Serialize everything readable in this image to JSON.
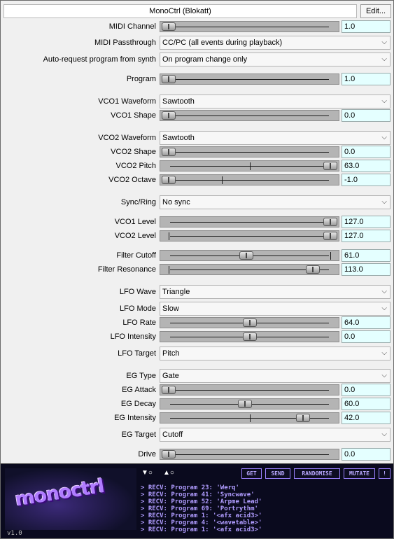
{
  "window": {
    "title": "MonoCtrl (Blokatt)",
    "edit_label": "Edit..."
  },
  "controls": [
    {
      "kind": "slider",
      "label": "MIDI Channel",
      "value": "1.0",
      "level": 0.0
    },
    {
      "kind": "dropdown",
      "label": "MIDI Passthrough",
      "value": "CC/PC (all events during playback)"
    },
    {
      "kind": "dropdown",
      "label": "Auto-request program from synth",
      "value": "On program change only"
    },
    {
      "kind": "slider",
      "label": "Program",
      "value": "1.0",
      "level": 0.0
    },
    {
      "kind": "dropdown",
      "label": "VCO1 Waveform",
      "value": "Sawtooth"
    },
    {
      "kind": "slider",
      "label": "VCO1 Shape",
      "value": "0.0",
      "level": 0.0
    },
    {
      "kind": "dropdown",
      "label": "VCO2 Waveform",
      "value": "Sawtooth"
    },
    {
      "kind": "slider",
      "label": "VCO2 Shape",
      "value": "0.0",
      "level": 0.0
    },
    {
      "kind": "slider",
      "label": "VCO2 Pitch",
      "value": "63.0",
      "level": 1.0,
      "tick": 0.5
    },
    {
      "kind": "slider",
      "label": "VCO2 Octave",
      "value": "-1.0",
      "level": 0.0,
      "tick": 0.33
    },
    {
      "kind": "dropdown",
      "label": "Sync/Ring",
      "value": "No sync"
    },
    {
      "kind": "slider",
      "label": "VCO1 Level",
      "value": "127.0",
      "level": 1.0
    },
    {
      "kind": "slider",
      "label": "VCO2 Level",
      "value": "127.0",
      "level": 1.0,
      "tick": 0.0
    },
    {
      "kind": "slider",
      "label": "Filter Cutoff",
      "value": "61.0",
      "level": 0.48,
      "tick": 1.0
    },
    {
      "kind": "slider",
      "label": "Filter Resonance",
      "value": "113.0",
      "level": 0.89,
      "tick": 0.0
    },
    {
      "kind": "dropdown",
      "label": "LFO Wave",
      "value": "Triangle"
    },
    {
      "kind": "dropdown",
      "label": "LFO Mode",
      "value": "Slow"
    },
    {
      "kind": "slider",
      "label": "LFO Rate",
      "value": "64.0",
      "level": 0.5
    },
    {
      "kind": "slider",
      "label": "LFO Intensity",
      "value": "0.0",
      "level": 0.5
    },
    {
      "kind": "dropdown",
      "label": "LFO Target",
      "value": "Pitch"
    },
    {
      "kind": "dropdown",
      "label": "EG Type",
      "value": "Gate"
    },
    {
      "kind": "slider",
      "label": "EG Attack",
      "value": "0.0",
      "level": 0.0
    },
    {
      "kind": "slider",
      "label": "EG Decay",
      "value": "60.0",
      "level": 0.47
    },
    {
      "kind": "slider",
      "label": "EG Intensity",
      "value": "42.0",
      "level": 0.83,
      "tick": 0.5
    },
    {
      "kind": "dropdown",
      "label": "EG Target",
      "value": "Cutoff"
    },
    {
      "kind": "slider",
      "label": "Drive",
      "value": "0.0",
      "level": 0.0
    }
  ],
  "panel": {
    "logo_text": "monoctrl",
    "version": "v1.0",
    "down_label": "▼○",
    "up_label": "▲○",
    "buttons": [
      "GET",
      "SEND",
      "RANDOMISE",
      "MUTATE",
      "!"
    ],
    "log": [
      "> RECV: Program 23: 'Werq'",
      "> RECV: Program 41: 'Syncwave'",
      "> RECV: Program 52: 'Arpme Lead'",
      "> RECV: Program 69: 'Portrythm'",
      "> RECV: Program 1: '<afx acid3>'",
      "> RECV: Program 4: '<wavetable>'",
      "> RECV: Program 1: '<afx acid3>'"
    ]
  },
  "colors": {
    "value_box": "#e4ffff",
    "panel_bg": "#0a0a1e",
    "panel_accent": "#9b82ff"
  }
}
